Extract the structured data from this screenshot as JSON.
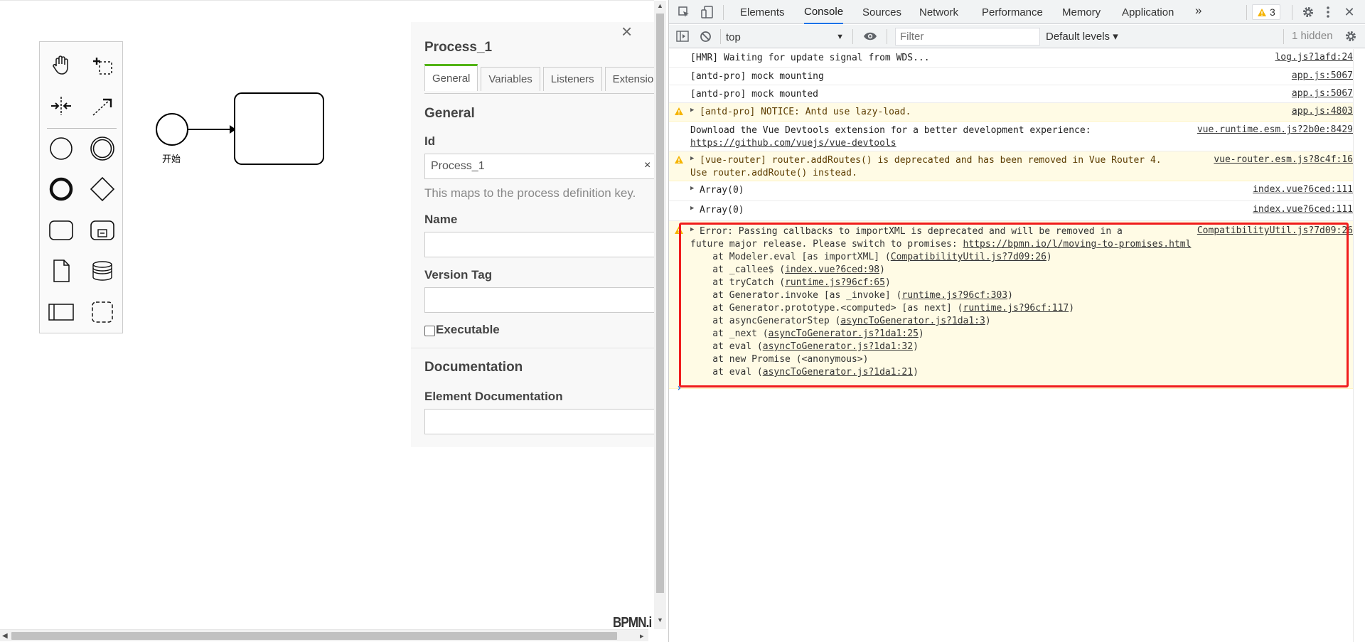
{
  "app": {
    "start_event_label": "开始",
    "bpmn_logo": "BPMN.i",
    "palette": [
      {
        "icon": "hand-tool-icon"
      },
      {
        "icon": "lasso-tool-icon"
      },
      {
        "icon": "space-tool-icon"
      },
      {
        "icon": "global-connect-icon"
      },
      {
        "icon": "start-event-icon"
      },
      {
        "icon": "intermediate-event-icon"
      },
      {
        "icon": "end-event-icon"
      },
      {
        "icon": "gateway-icon"
      },
      {
        "icon": "task-icon"
      },
      {
        "icon": "subprocess-icon"
      },
      {
        "icon": "data-object-icon"
      },
      {
        "icon": "data-store-icon"
      },
      {
        "icon": "participant-icon"
      },
      {
        "icon": "group-icon"
      }
    ]
  },
  "properties": {
    "title": "Process_1",
    "close": "×",
    "tabs": [
      "General",
      "Variables",
      "Listeners",
      "Extensions"
    ],
    "active_tab": "General",
    "section_general": "General",
    "id_label": "Id",
    "id_value": "Process_1",
    "id_clear": "×",
    "id_hint": "This maps to the process definition key.",
    "name_label": "Name",
    "name_value": "",
    "version_label": "Version Tag",
    "version_value": "",
    "executable_label": "Executable",
    "section_documentation": "Documentation",
    "element_doc_label": "Element Documentation",
    "element_doc_value": ""
  },
  "devtools": {
    "tabs": [
      "Elements",
      "Console",
      "Sources",
      "Network",
      "Performance",
      "Memory",
      "Application"
    ],
    "active_tab": "Console",
    "more": "»",
    "warning_count": "3",
    "context": "top",
    "filter_placeholder": "Filter",
    "levels": "Default levels ▾",
    "hidden": "1 hidden",
    "logs": [
      {
        "type": "log",
        "msg": "[HMR] Waiting for update signal from WDS...",
        "src": "log.js?1afd:24"
      },
      {
        "type": "log",
        "msg": "[antd-pro] mock mounting",
        "src": "app.js:5067"
      },
      {
        "type": "log",
        "msg": "[antd-pro] mock mounted",
        "src": "app.js:5067"
      },
      {
        "type": "warn",
        "msg": "[antd-pro] NOTICE: Antd use lazy-load.",
        "src": "app.js:4803"
      },
      {
        "type": "log",
        "msg": "Download the Vue Devtools extension for a better development experience:",
        "link": "https://github.com/vuejs/vue-devtools",
        "src": "vue.runtime.esm.js?2b0e:8429"
      },
      {
        "type": "warn",
        "msg": "[vue-router] router.addRoutes() is deprecated and has been removed in Vue Router 4.",
        "msg2": "Use router.addRoute() instead.",
        "src": "vue-router.esm.js?8c4f:16"
      },
      {
        "type": "log",
        "msg": "Array(0)",
        "src": "index.vue?6ced:111"
      },
      {
        "type": "log",
        "msg": "Array(0)",
        "src": "index.vue?6ced:111"
      }
    ],
    "error": {
      "line1": "Error: Passing callbacks to importXML is deprecated and will be removed in a",
      "line2_text": "future major release. Please switch to promises: ",
      "line2_link": "https://bpmn.io/l/moving-to-promises.html",
      "src": "CompatibilityUtil.js?7d09:26",
      "stack": [
        {
          "pre": "    at Modeler.eval [as importXML] (",
          "link": "CompatibilityUtil.js?7d09:26",
          "post": ")"
        },
        {
          "pre": "    at _callee$ (",
          "link": "index.vue?6ced:98",
          "post": ")"
        },
        {
          "pre": "    at tryCatch (",
          "link": "runtime.js?96cf:65",
          "post": ")"
        },
        {
          "pre": "    at Generator.invoke [as _invoke] (",
          "link": "runtime.js?96cf:303",
          "post": ")"
        },
        {
          "pre": "    at Generator.prototype.<computed> [as next] (",
          "link": "runtime.js?96cf:117",
          "post": ")"
        },
        {
          "pre": "    at asyncGeneratorStep (",
          "link": "asyncToGenerator.js?1da1:3",
          "post": ")"
        },
        {
          "pre": "    at _next (",
          "link": "asyncToGenerator.js?1da1:25",
          "post": ")"
        },
        {
          "pre": "    at eval (",
          "link": "asyncToGenerator.js?1da1:32",
          "post": ")"
        },
        {
          "pre": "    at new Promise (<anonymous>)",
          "link": "",
          "post": ""
        },
        {
          "pre": "    at eval (",
          "link": "asyncToGenerator.js?1da1:21",
          "post": ")"
        }
      ]
    }
  }
}
